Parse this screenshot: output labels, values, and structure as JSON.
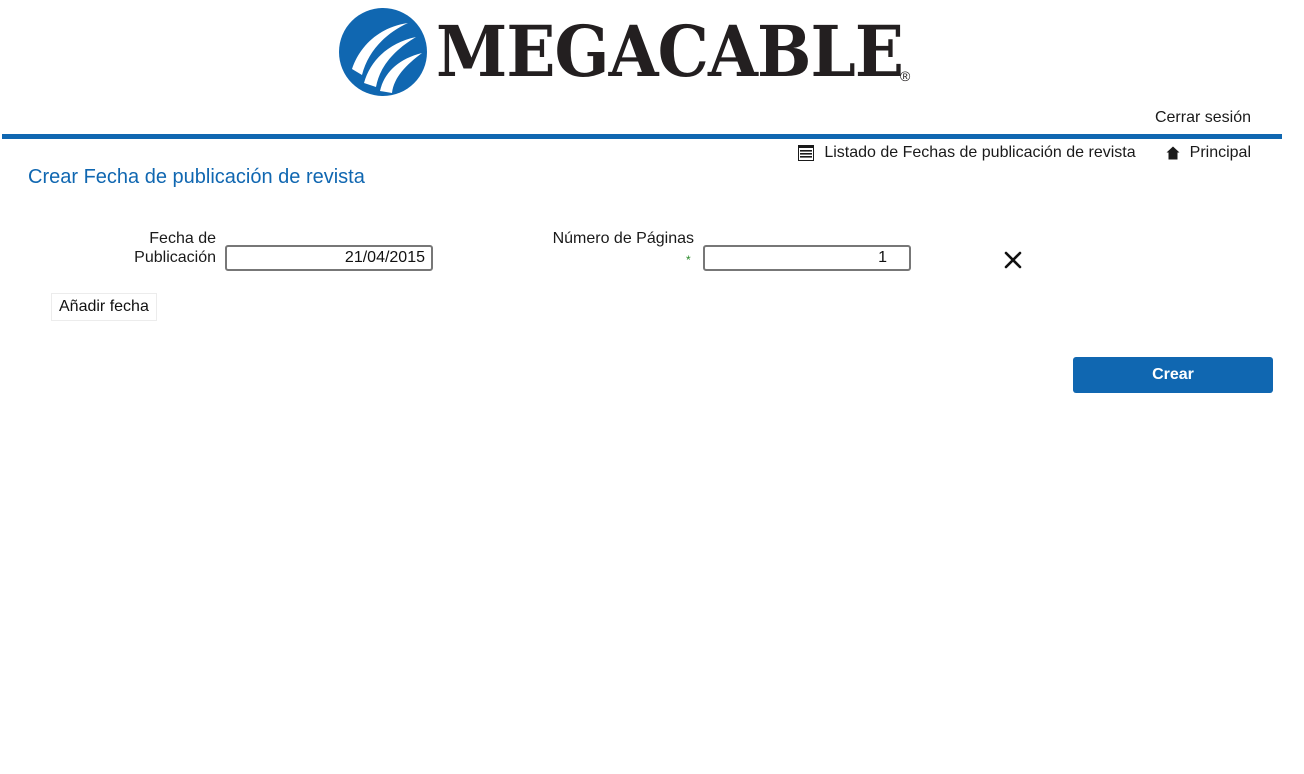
{
  "brand": {
    "name": "MEGACABLE",
    "registered": "®",
    "logo_icon": "megacable-swoosh-icon",
    "color": "#1067b1"
  },
  "header": {
    "logout_label": "Cerrar sesión"
  },
  "subnav": {
    "items": [
      {
        "label": "Listado de Fechas de publicación de revista",
        "icon": "list-icon"
      },
      {
        "label": "Principal",
        "icon": "home-icon"
      }
    ]
  },
  "main": {
    "title": "Crear Fecha de publicación de revista",
    "form": {
      "fecha_label": "Fecha de Publicación",
      "fecha_value": "21/04/2015",
      "paginas_label": "Número de Páginas",
      "paginas_required_mark": "*",
      "paginas_value": "1",
      "remove_icon": "close-icon",
      "add_date_label": "Añadir fecha",
      "submit_label": "Crear"
    }
  }
}
